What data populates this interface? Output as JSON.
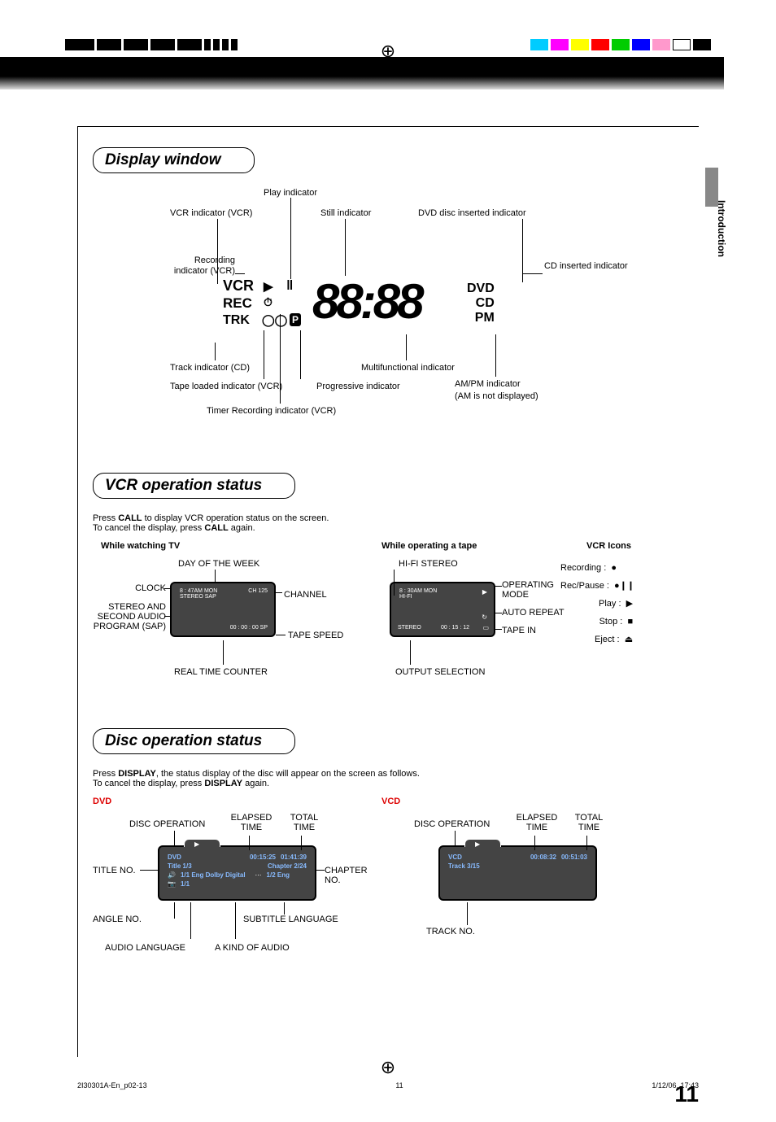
{
  "side_tab": "Introduction",
  "page_number": "11",
  "footer": {
    "left": "2I30301A-En_p02-13",
    "mid": "11",
    "right": "1/12/06, 17:43"
  },
  "section1": {
    "title": "Display window",
    "labels": {
      "play": "Play indicator",
      "vcr_ind": "VCR indicator (VCR)",
      "still": "Still indicator",
      "dvd_inserted": "DVD disc inserted indicator",
      "recording": "Recording indicator (VCR)",
      "cd_inserted": "CD inserted indicator",
      "track": "Track indicator (CD)",
      "tape_loaded": "Tape loaded indicator (VCR)",
      "timer_rec": "Timer Recording indicator (VCR)",
      "progressive": "Progressive indicator",
      "multifunc": "Multifunctional indicator",
      "ampm": "AM/PM indicator",
      "ampm_note": "(AM is not displayed)"
    },
    "display": {
      "vcr": "VCR",
      "rec": "REC",
      "trk": "TRK",
      "digits": "88:88",
      "dvd": "DVD",
      "cd": "CD",
      "pm": "PM"
    }
  },
  "section2": {
    "title": "VCR operation status",
    "intro1a": "Press ",
    "intro1b": "CALL",
    "intro1c": " to display VCR operation status on the screen.",
    "intro2a": "To cancel the display, press ",
    "intro2b": "CALL",
    "intro2c": " again.",
    "tv_head": "While watching TV",
    "tape_head": "While operating a tape",
    "icons_head": "VCR Icons",
    "tv_labels": {
      "day": "DAY OF THE WEEK",
      "clock": "CLOCK",
      "channel": "CHANNEL",
      "sap": "STEREO AND SECOND AUDIO PROGRAM (SAP)",
      "tapespeed": "TAPE SPEED",
      "rtc": "REAL TIME COUNTER"
    },
    "tv_osd": {
      "time": "8 : 47AM   MON",
      "stereo": "STEREO  SAP",
      "ch": "CH 125",
      "counter": "00 : 00 : 00   SP"
    },
    "tape_labels": {
      "hifi": "HI-FI STEREO",
      "opmode": "OPERATING MODE",
      "autorep": "AUTO REPEAT",
      "tapein": "TAPE IN",
      "outsel": "OUTPUT SELECTION"
    },
    "tape_osd": {
      "time": "8 : 30AM   MON",
      "hifi": "HI-FI",
      "counter": "00 : 15 : 12",
      "stereo": "STEREO"
    },
    "icons": {
      "recording": "Recording :",
      "recpause": "Rec/Pause :",
      "play": "Play :",
      "stop": "Stop :",
      "eject": "Eject :"
    }
  },
  "section3": {
    "title": "Disc operation status",
    "intro1a": "Press ",
    "intro1b": "DISPLAY",
    "intro1c": ", the status display of the disc will appear on the screen as follows.",
    "intro2a": "To cancel the display, press ",
    "intro2b": "DISPLAY",
    "intro2c": " again.",
    "dvd_head": "DVD",
    "vcd_head": "VCD",
    "dvd_labels": {
      "discop": "DISC OPERATION",
      "elapsed": "ELAPSED TIME",
      "total": "TOTAL TIME",
      "title": "TITLE NO.",
      "chapter": "CHAPTER NO.",
      "angle": "ANGLE NO.",
      "sublang": "SUBTITLE LANGUAGE",
      "audiolang": "AUDIO LANGUAGE",
      "audiokind": "A KIND OF AUDIO"
    },
    "dvd_osd": {
      "tag": "DVD",
      "elapsed": "00:15:25",
      "total": "01:41:39",
      "title": "Title   1/3",
      "chapter": "Chapter 2/24",
      "audio": "1/1 Eng Dolby Digital",
      "sub": "1/2  Eng",
      "angle": "1/1"
    },
    "vcd_labels": {
      "discop": "DISC OPERATION",
      "elapsed": "ELAPSED TIME",
      "total": "TOTAL TIME",
      "trackno": "TRACK NO."
    },
    "vcd_osd": {
      "tag": "VCD",
      "elapsed": "00:08:32",
      "total": "00:51:03",
      "track": "Track  3/15"
    }
  }
}
